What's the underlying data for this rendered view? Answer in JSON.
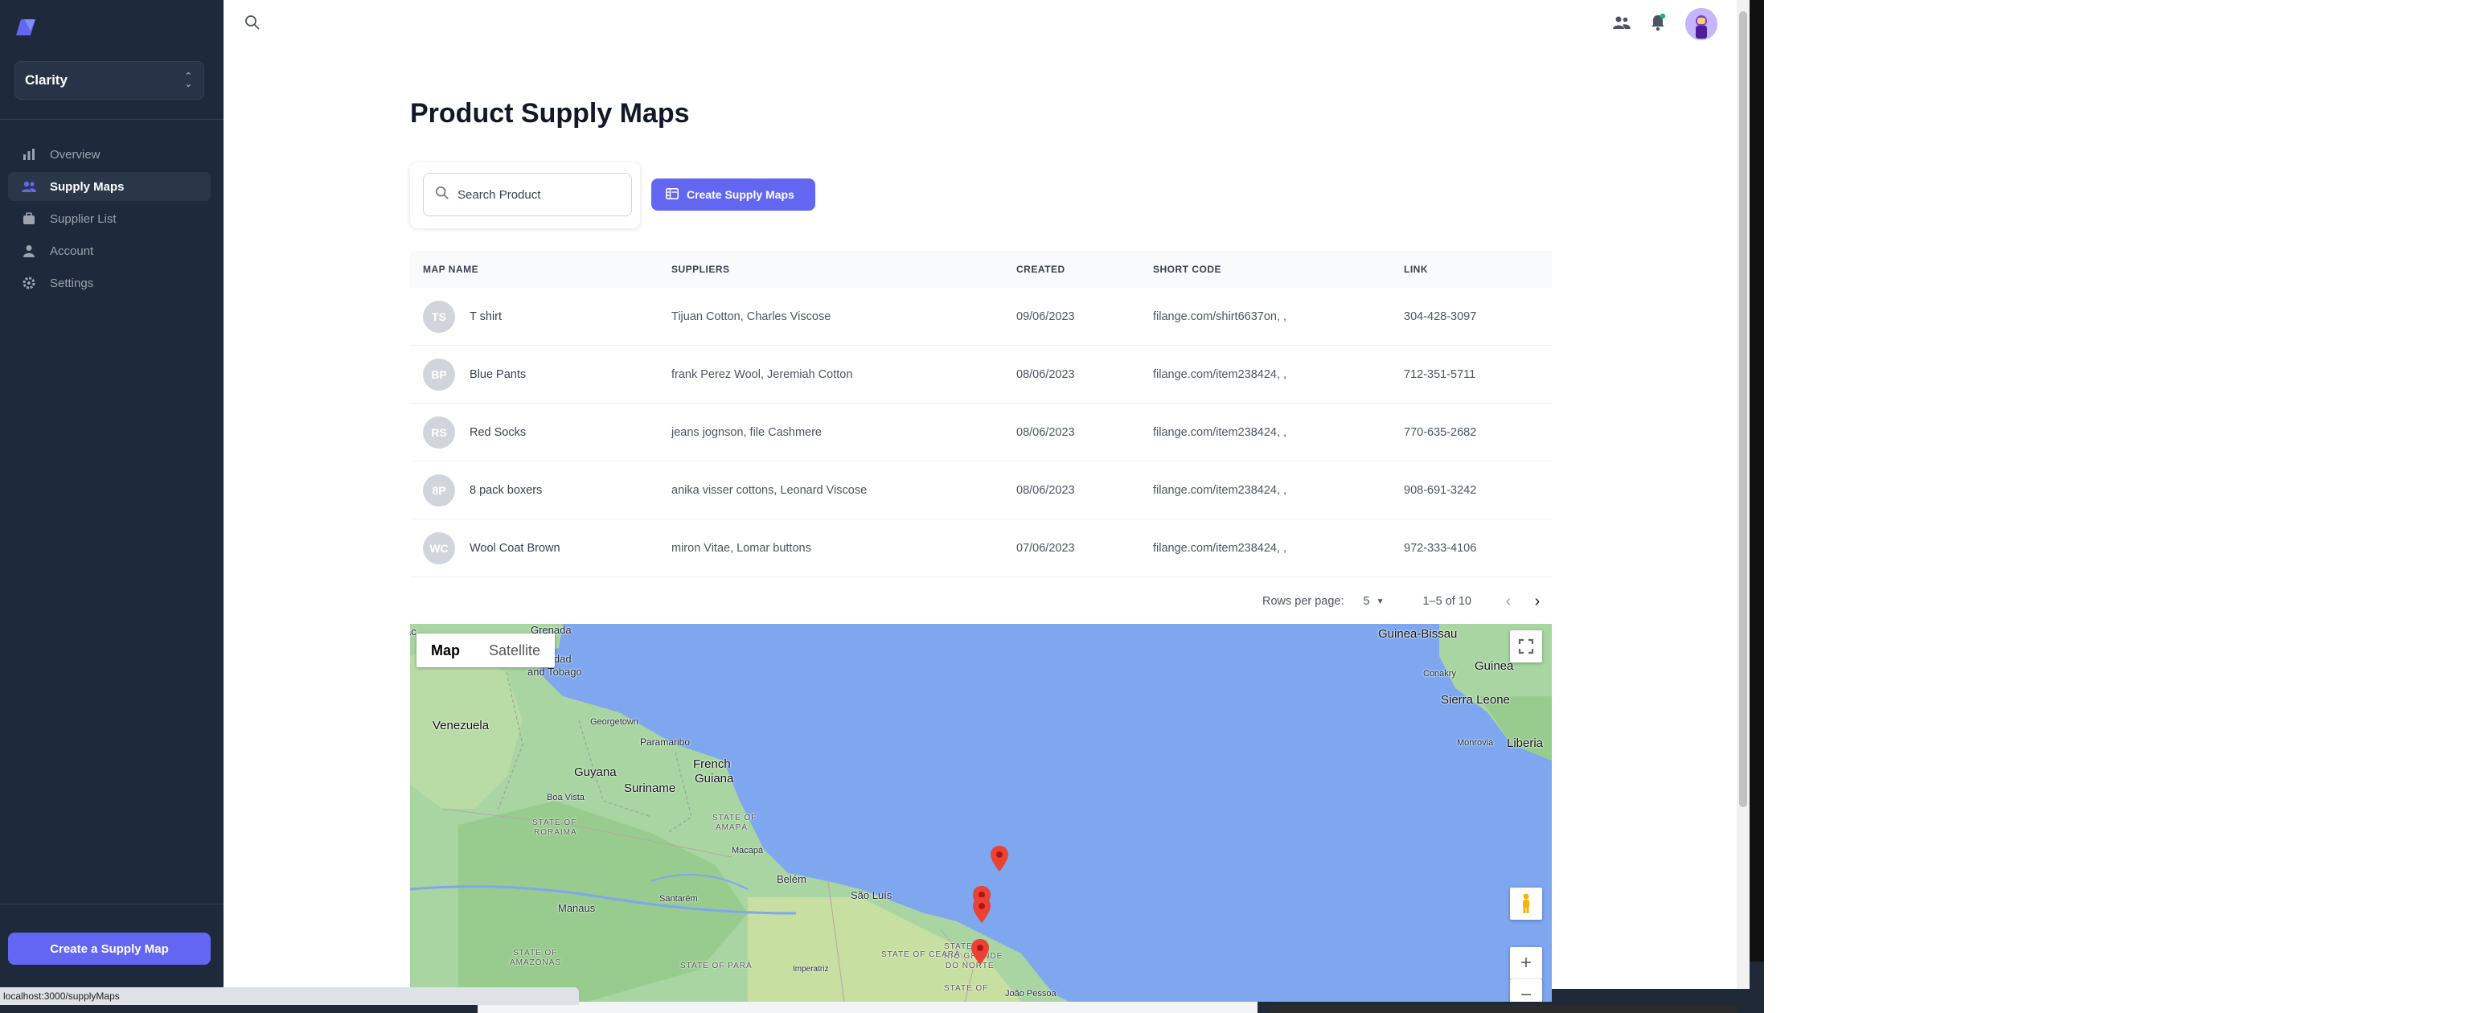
{
  "sidebar": {
    "workspace": "Clarity",
    "nav": [
      {
        "label": "Overview",
        "icon": "chart-bar-icon"
      },
      {
        "label": "Supply Maps",
        "icon": "users-icon",
        "active": true
      },
      {
        "label": "Supplier List",
        "icon": "briefcase-icon"
      },
      {
        "label": "Account",
        "icon": "user-icon"
      },
      {
        "label": "Settings",
        "icon": "gear-icon"
      }
    ],
    "create_button": "Create a Supply Map"
  },
  "header": {
    "title": "Product Supply Maps"
  },
  "search": {
    "placeholder": "Search Product"
  },
  "toolbar": {
    "create_label": "Create Supply Maps"
  },
  "table": {
    "columns": [
      "MAP NAME",
      "SUPPLIERS",
      "CREATED",
      "SHORT CODE",
      "LINK"
    ],
    "rows": [
      {
        "initials": "TS",
        "name": "T shirt",
        "suppliers": "Tijuan Cotton, Charles Viscose",
        "created": "09/06/2023",
        "short_code": "filange.com/shirt6637on, ,",
        "link": "304-428-3097"
      },
      {
        "initials": "BP",
        "name": "Blue Pants",
        "suppliers": "frank Perez Wool, Jeremiah Cotton",
        "created": "08/06/2023",
        "short_code": "filange.com/item238424, ,",
        "link": "712-351-5711"
      },
      {
        "initials": "RS",
        "name": "Red Socks",
        "suppliers": "jeans jognson, file Cashmere",
        "created": "08/06/2023",
        "short_code": "filange.com/item238424, ,",
        "link": "770-635-2682"
      },
      {
        "initials": "8P",
        "name": "8 pack boxers",
        "suppliers": "anika visser cottons, Leonard Viscose",
        "created": "08/06/2023",
        "short_code": "filange.com/item238424, ,",
        "link": "908-691-3242"
      },
      {
        "initials": "WC",
        "name": "Wool Coat Brown",
        "suppliers": "miron Vitae, Lomar buttons",
        "created": "07/06/2023",
        "short_code": "filange.com/item238424, ,",
        "link": "972-333-4106"
      }
    ]
  },
  "pagination": {
    "rows_per_page_label": "Rows per page:",
    "rows_per_page": "5",
    "range": "1–5 of 10"
  },
  "map": {
    "toggle_map": "Map",
    "toggle_satellite": "Satellite",
    "labels": {
      "venezuela": "Venezuela",
      "guyana": "Guyana",
      "suriname": "Suriname",
      "french_guiana_1": "French",
      "french_guiana_2": "Guiana",
      "belem": "Belém",
      "sao_luis": "São Luís",
      "manaus": "Manaus",
      "santarem": "Santarém",
      "macapa": "Macapá",
      "paramaribo": "Paramaribo",
      "georgetown": "Georgetown",
      "boa_vista": "Boa Vista",
      "trinidad_1": "idad",
      "trinidad_2": "and Tobago",
      "grenada": "Grenada",
      "guinea_bissau": "Guinea-Bissau",
      "guinea": "Guinea",
      "conakry": "Conakry",
      "sierra_leone": "Sierra Leone",
      "monrovia": "Monrovia",
      "liberia": "Liberia",
      "state_roraima_1": "STATE OF",
      "state_roraima_2": "RORAIMA",
      "state_amapa_1": "STATE OF",
      "state_amapa_2": "AMAPÁ",
      "state_amazonas_1": "STATE OF",
      "state_amazonas_2": "AMAZONAS",
      "state_para": "STATE OF PARÁ",
      "state_ceara": "STATE OF CEARÁ",
      "state_rn_1": "STATE OF",
      "state_rn_2": "RIO GRANDE",
      "state_rn_3": "DO NORTE",
      "state_pb": "STATE OF",
      "joao_pessoa": "João Pessoa",
      "imperatriz": "Imperatriz",
      "ac": "ac"
    }
  },
  "status_url": "localhost:3000/supplyMaps",
  "colors": {
    "accent": "#6366f1",
    "sidebar_bg": "#1e293b",
    "ocean": "#7ea7ef",
    "land": "#a8d5a2"
  }
}
